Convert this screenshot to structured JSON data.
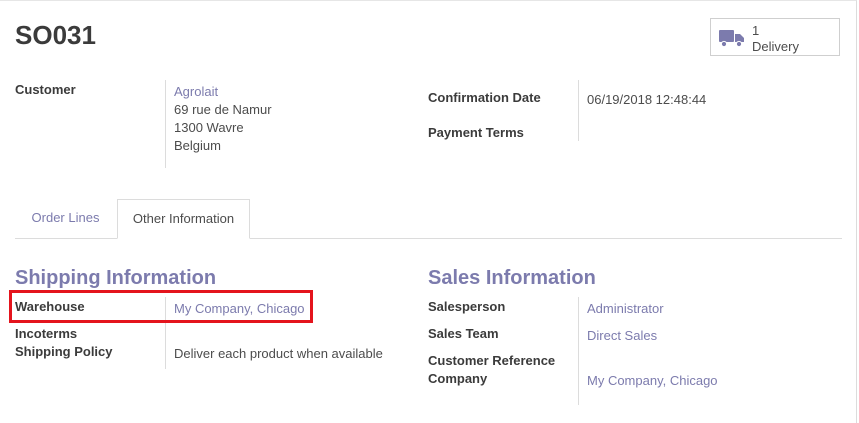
{
  "record": {
    "name": "SO031"
  },
  "smart_button": {
    "count": "1",
    "label": "Delivery",
    "icon": "truck-icon"
  },
  "customer": {
    "label": "Customer",
    "name": "Agrolait",
    "street": "69 rue de Namur",
    "city": "1300 Wavre",
    "country": "Belgium"
  },
  "confirmation_date": {
    "label": "Confirmation Date",
    "value": "06/19/2018 12:48:44"
  },
  "payment_terms": {
    "label": "Payment Terms",
    "value": ""
  },
  "tabs": [
    {
      "label": "Order Lines",
      "active": false
    },
    {
      "label": "Other Information",
      "active": true
    }
  ],
  "shipping": {
    "title": "Shipping Information",
    "warehouse_label": "Warehouse",
    "warehouse_value": "My Company, Chicago",
    "incoterms_label": "Incoterms",
    "incoterms_value": "",
    "policy_label": "Shipping Policy",
    "policy_value": "Deliver each product when available"
  },
  "sales": {
    "title": "Sales Information",
    "salesperson_label": "Salesperson",
    "salesperson_value": "Administrator",
    "team_label": "Sales Team",
    "team_value": "Direct Sales",
    "customer_ref_label": "Customer Reference",
    "customer_ref_value": "",
    "company_label": "Company",
    "company_value": "My Company, Chicago"
  },
  "colors": {
    "link": "#7c7bad",
    "highlight": "#e4141d"
  }
}
